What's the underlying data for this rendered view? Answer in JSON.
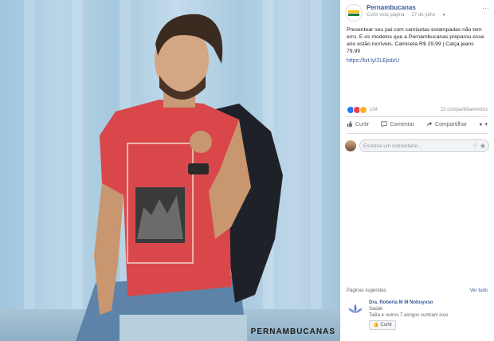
{
  "photo": {
    "watermark": "PERNAMBUCANAS",
    "shirt_print": "MANHATTAN"
  },
  "post": {
    "page_name": "Pernambucanas",
    "action": "Curtir esta página",
    "date": "27 de julho",
    "text": "Presentear seu pai com camisetas estampadas não tem erro. E os modelos que a Pernambucanas preparou esse ano estão incríveis. Camiseta R$ 29,99 | Calça jeans 79,99",
    "link": "https://bit.ly/2LEpdzU",
    "reaction_count": "104",
    "shares": "22 compartilhamentos"
  },
  "actions": {
    "like": "Curtir",
    "comment": "Comentar",
    "share": "Compartilhar"
  },
  "comment_box": {
    "placeholder": "Escreva um comentário..."
  },
  "suggestions": {
    "title": "Páginas sugeridas",
    "see_all": "Ver tudo",
    "item_name": "Dra. Roberta M M Nobuyuso",
    "item_category": "Saúde",
    "item_friends": "Talita e outros 7 amigos curtiram isso",
    "like_label": "Curtir"
  },
  "colors": {
    "link": "#385898",
    "like_blue": "#2078f4",
    "shirt_red": "#d9474b"
  }
}
